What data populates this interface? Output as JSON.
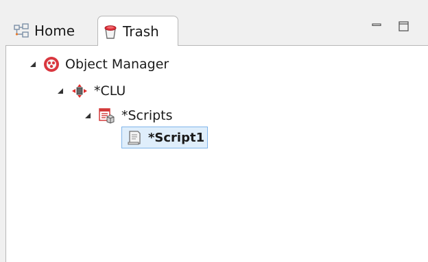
{
  "tabs": [
    {
      "label": "Home",
      "icon": "home-icon",
      "active": false
    },
    {
      "label": "Trash",
      "icon": "trash-icon",
      "active": true
    }
  ],
  "window_controls": {
    "minimize_icon": "minimize-icon",
    "maximize_icon": "maximize-icon"
  },
  "tree": {
    "root": {
      "label": "Object Manager",
      "icon": "object-manager-icon",
      "expanded": true
    },
    "clu": {
      "label": "*CLU",
      "icon": "clu-icon",
      "expanded": true
    },
    "scripts": {
      "label": "*Scripts",
      "icon": "scripts-icon",
      "expanded": true
    },
    "script1": {
      "label": "*Script1",
      "icon": "script-file-icon",
      "selected": true
    }
  },
  "colors": {
    "selection_bg": "#dfeefb",
    "selection_border": "#7eb4ea",
    "object_manager_red": "#d9373f",
    "clu_red": "#e02a2a"
  }
}
